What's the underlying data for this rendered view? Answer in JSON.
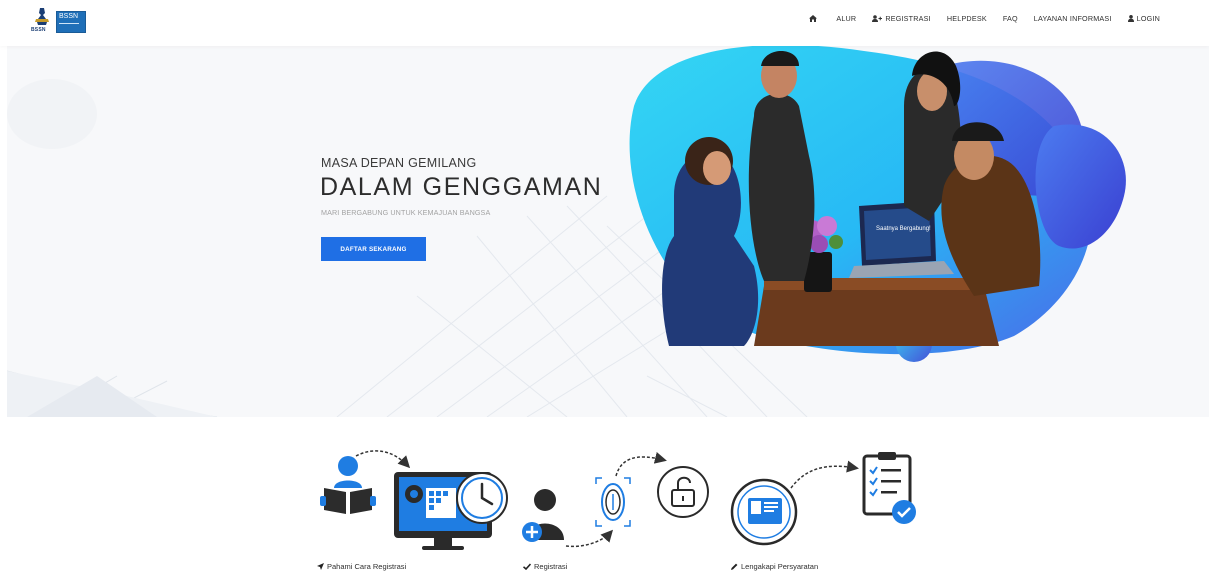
{
  "brand": {
    "mark_text": "BSSN",
    "box_text": "BSSN",
    "accent": "#1f6fe5"
  },
  "nav": {
    "items": [
      {
        "label": "",
        "icon": "home-icon"
      },
      {
        "label": "ALUR",
        "icon": ""
      },
      {
        "label": "REGISTRASI",
        "icon": "user-plus-icon"
      },
      {
        "label": "HELPDESK",
        "icon": ""
      },
      {
        "label": "FAQ",
        "icon": ""
      },
      {
        "label": "LAYANAN INFORMASI",
        "icon": ""
      },
      {
        "label": "LOGIN",
        "icon": "user-icon"
      }
    ]
  },
  "hero": {
    "kicker": "MASA DEPAN GEMILANG",
    "title": "DALAM GENGGAMAN",
    "subtitle": "MARI BERGABUNG UNTUK KEMAJUAN BANGSA",
    "cta_label": "DAFTAR SEKARANG",
    "laptop_text": "Saatnya Bergabung!"
  },
  "steps": [
    {
      "label": "Pahami Cara Registrasi",
      "icon": "paper-plane-icon"
    },
    {
      "label": "Registrasi",
      "icon": "check-icon"
    },
    {
      "label": "Lengakapi Persyaratan",
      "icon": "pencil-icon"
    }
  ]
}
